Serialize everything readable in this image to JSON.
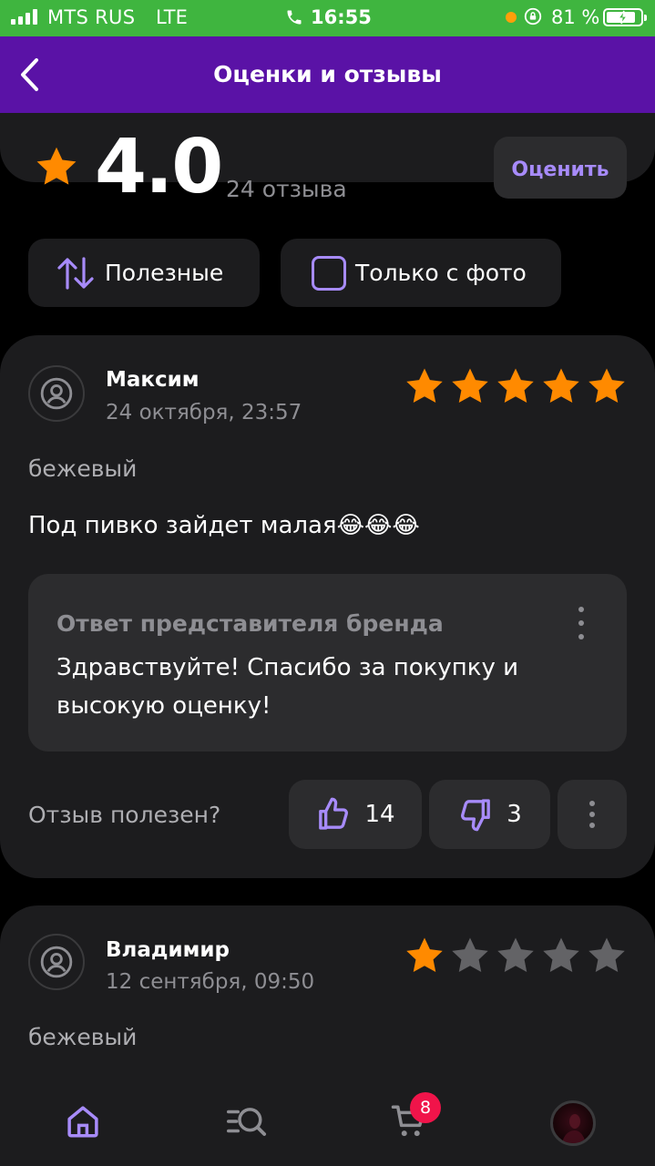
{
  "status_bar": {
    "carrier": "MTS RUS",
    "network": "LTE",
    "time": "16:55",
    "battery_percent": "81 %",
    "battery_level": 0.81
  },
  "header": {
    "title": "Оценки и отзывы",
    "back_icon": "chevron-left-icon"
  },
  "summary": {
    "rating": "4.0",
    "reviews_count": "24 отзыва",
    "rate_button": "Оценить"
  },
  "filters": {
    "sort_label": "Полезные",
    "photo_only_label": "Только с фото",
    "photo_only_checked": false
  },
  "reviews": [
    {
      "author": "Максим",
      "date": "24 октября, 23:57",
      "stars": 5,
      "variant": "бежевый",
      "text": "Под пивко зайдет малая😂😂😂",
      "reply": {
        "title": "Ответ представителя бренда",
        "text": "Здравствуйте! Спасибо за покупку и высокую оценку!"
      },
      "helpful_question": "Отзыв полезен?",
      "likes": "14",
      "dislikes": "3"
    },
    {
      "author": "Владимир",
      "date": "12 сентября, 09:50",
      "stars": 1,
      "variant": "бежевый"
    }
  ],
  "tab_bar": {
    "items": [
      "home-icon",
      "catalog-search-icon",
      "cart-icon",
      "profile-avatar"
    ],
    "cart_badge": "8",
    "active": "home-icon"
  },
  "colors": {
    "header_bg": "#5a12a6",
    "status_bar_bg": "#3fb53f",
    "accent": "#a78bfa",
    "star_active": "#ff8a00",
    "star_inactive": "#636366",
    "badge": "#f0144a",
    "card_bg": "#1c1c1e"
  }
}
